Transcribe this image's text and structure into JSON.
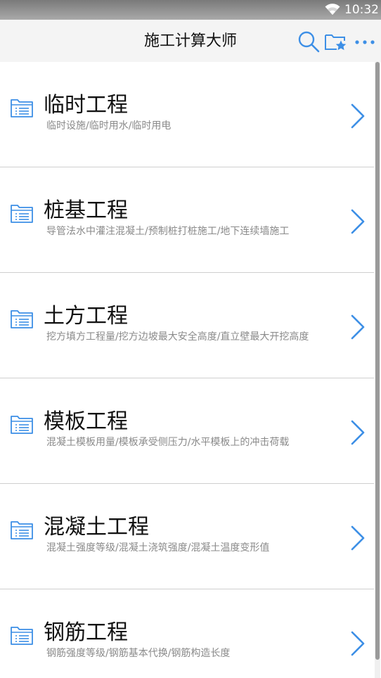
{
  "status_bar": {
    "time": "10:32"
  },
  "app_bar": {
    "title": "施工计算大师",
    "accent_color": "#3d8fe6"
  },
  "items": [
    {
      "title": "临时工程",
      "subtitle": "临时设施/临时用水/临时用电"
    },
    {
      "title": "桩基工程",
      "subtitle": "导管法水中灌注混凝土/预制桩打桩施工/地下连续墙施工"
    },
    {
      "title": "土方工程",
      "subtitle": "挖方填方工程量/挖方边坡最大安全高度/直立壁最大开挖高度"
    },
    {
      "title": "模板工程",
      "subtitle": "混凝土模板用量/模板承受侧压力/水平模板上的冲击荷载"
    },
    {
      "title": "混凝土工程",
      "subtitle": "混凝土强度等级/混凝土浇筑强度/混凝土温度变形值"
    },
    {
      "title": "钢筋工程",
      "subtitle": "钢筋强度等级/钢筋基本代换/钢筋构造长度"
    }
  ]
}
